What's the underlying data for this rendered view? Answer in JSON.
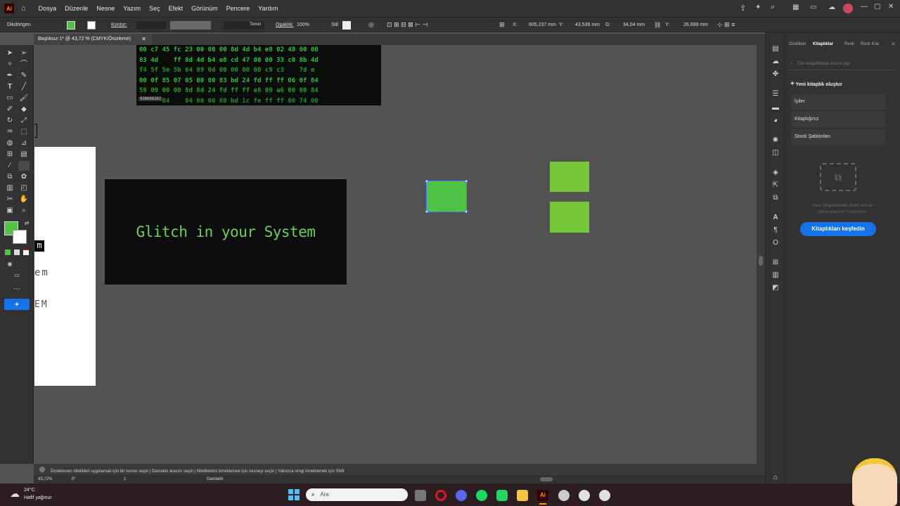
{
  "menubar": {
    "app_logo": "Ai",
    "items": [
      "Dosya",
      "Düzenle",
      "Nesne",
      "Yazım",
      "Seç",
      "Efekt",
      "Görünüm",
      "Pencere",
      "Yardım"
    ]
  },
  "control_bar": {
    "object_label": "Dikdörtgen",
    "stroke_label": "Kontur:",
    "stroke_style": "Temel",
    "opacity_label": "Opaklık:",
    "opacity_value": "100%",
    "style_label": "Stil:",
    "x_label": "X:",
    "x_value": "605,237 mm",
    "y_label": "Y:",
    "y_value": "43,536 mm",
    "w_label": "G:",
    "w_value": "34,04 mm",
    "h_label": "Y:",
    "h_value": "26,699 mm",
    "fill_color": "#4ec345"
  },
  "document": {
    "tab_title": "Başlıksız-1* @ 43,72 % (CMYK/Önizleme)"
  },
  "artboard": {
    "hex_lines": [
      "00 c7 45 fc 23 00 00 00 8d 4d b4 e8 02 48 00 00",
      "83 4d    ff 8d 4d b4 e8 cd 47 00 00 33 c0 8b 4d",
      "f4 5f 5e 5b 64 89 0d 00 00 00 00 c9 c3    7d e",
      "00 0f 85 07 05 00 00 83 bd 24 fd ff ff 06 0f 84",
      "59 09 00 00 8d 8d 24 fd ff ff e8 09 a6 00 00 84",
      "      84    04 00 00 80 bd 1c fe ff ff 00 74 00"
    ],
    "hex_label": "938688282",
    "banner_text": "Glitch in your System",
    "side_text_1": "m",
    "side_text_2": "em",
    "side_text_3": "EM",
    "banner_text_color": "#6cd152",
    "square_color_selected": "#4ec345",
    "square_color": "#76c83a"
  },
  "status": {
    "hint": "Örneklenen nitelikleri uygulamak için bir nesne seçin  |  Damlalık aracını seçin  |  Niteliklerini örneklemek için nesneyi seçin  |  Yalnızca rengi örneklemek için Shift"
  },
  "zoom": {
    "level": "43,72%",
    "rotation": "0°",
    "artboard_num": "1",
    "tool_name": "Damlalık"
  },
  "panel": {
    "tabs": [
      "Özellikler",
      "Kitaplıklar",
      "Renk",
      "Renk Kıla"
    ],
    "search_placeholder": "Tüm kitaplıklarda arama yap",
    "new_library": "Yeni kitaplık oluştur",
    "libraries": [
      "İyiler",
      "Kitaplığınız",
      "Stock Şablonları"
    ],
    "empty_text_1": "Hazır kitaplıklardan ilham alın ve",
    "empty_text_2": "çalışmalarınızı hızlandırın",
    "explore_button": "Kitaplıkları keşfedin"
  },
  "taskbar": {
    "weather_temp": "24°C",
    "weather_desc": "Hafif yağmur",
    "search_placeholder": "Ara"
  }
}
